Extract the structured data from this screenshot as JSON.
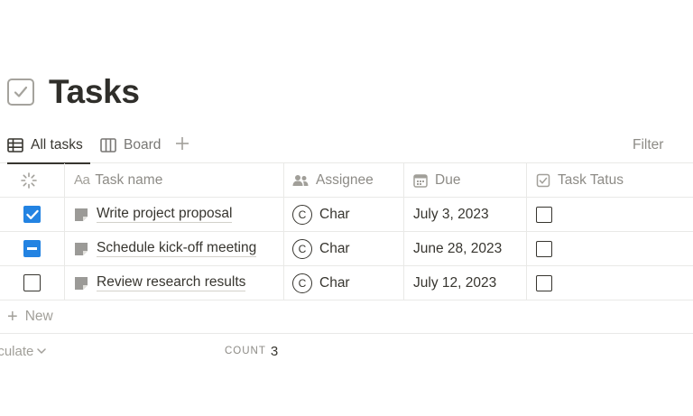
{
  "page": {
    "title": "Tasks",
    "icon": "checkbox-icon"
  },
  "views": {
    "tabs": [
      {
        "label": "All tasks",
        "icon": "table-icon",
        "active": true
      },
      {
        "label": "Board",
        "icon": "board-icon",
        "active": false
      }
    ],
    "add_icon": "plus-icon",
    "filter_label": "Filter"
  },
  "table": {
    "columns": [
      {
        "label": "",
        "icon": "spinner-icon"
      },
      {
        "label": "Task name",
        "icon": "text-property-icon",
        "prefix": "Aa"
      },
      {
        "label": "Assignee",
        "icon": "people-icon"
      },
      {
        "label": "Due",
        "icon": "calendar-icon"
      },
      {
        "label": "Task Tatus",
        "icon": "checkbox-property-icon"
      }
    ],
    "rows": [
      {
        "selection": "checked",
        "name": "Write project proposal",
        "assignee": "Char",
        "assignee_initial": "C",
        "due": "July 3, 2023",
        "status_checked": false
      },
      {
        "selection": "partial",
        "name": "Schedule kick-off meeting",
        "assignee": "Char",
        "assignee_initial": "C",
        "due": "June 28, 2023",
        "status_checked": false
      },
      {
        "selection": "unchecked",
        "name": "Review research results",
        "assignee": "Char",
        "assignee_initial": "C",
        "due": "July 12, 2023",
        "status_checked": false
      }
    ],
    "new_label": "New"
  },
  "footer": {
    "calculate_label": "lculate",
    "count_label": "COUNT",
    "count_value": "3"
  },
  "colors": {
    "accent": "#2383e2",
    "text": "#37352f",
    "muted": "#8d8b86",
    "border": "#e9e9e7"
  }
}
